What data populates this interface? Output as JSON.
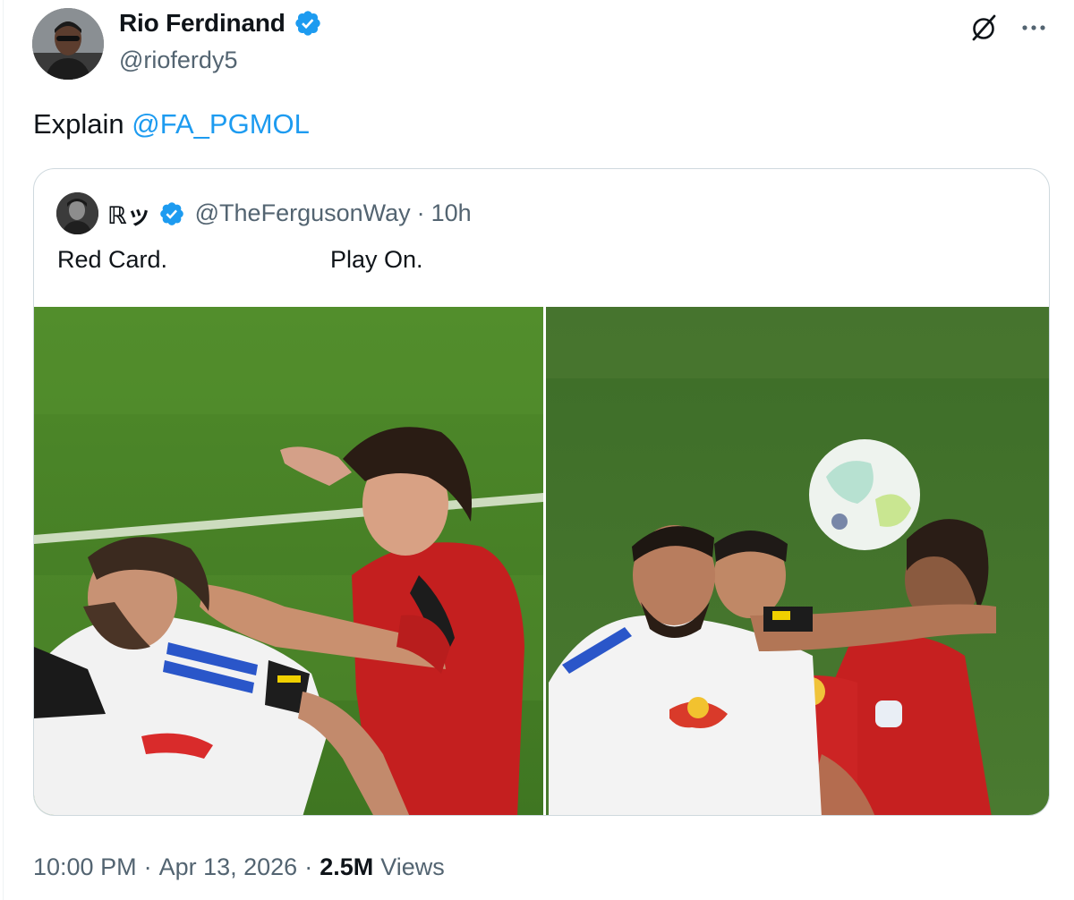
{
  "author": {
    "name": "Rio Ferdinand",
    "handle": "@rioferdy5"
  },
  "tweet": {
    "text_prefix": "Explain ",
    "mention": "@FA_PGMOL"
  },
  "quoted": {
    "name": "ℝッ",
    "handle": "@TheFergusonWay",
    "separator": "·",
    "time": "10h",
    "text_left": "Red Card.",
    "text_right": "Play On."
  },
  "footer": {
    "time": "10:00 PM",
    "separator": "·",
    "date": "Apr 13, 2026",
    "views_count": "2.5M",
    "views_label": "Views"
  },
  "colors": {
    "link": "#1d9bf0",
    "secondary_text": "#536471",
    "border": "#cfd9de",
    "verified": "#1d9bf0"
  },
  "icons": [
    "verified-badge-icon",
    "grok-icon",
    "more-icon"
  ]
}
